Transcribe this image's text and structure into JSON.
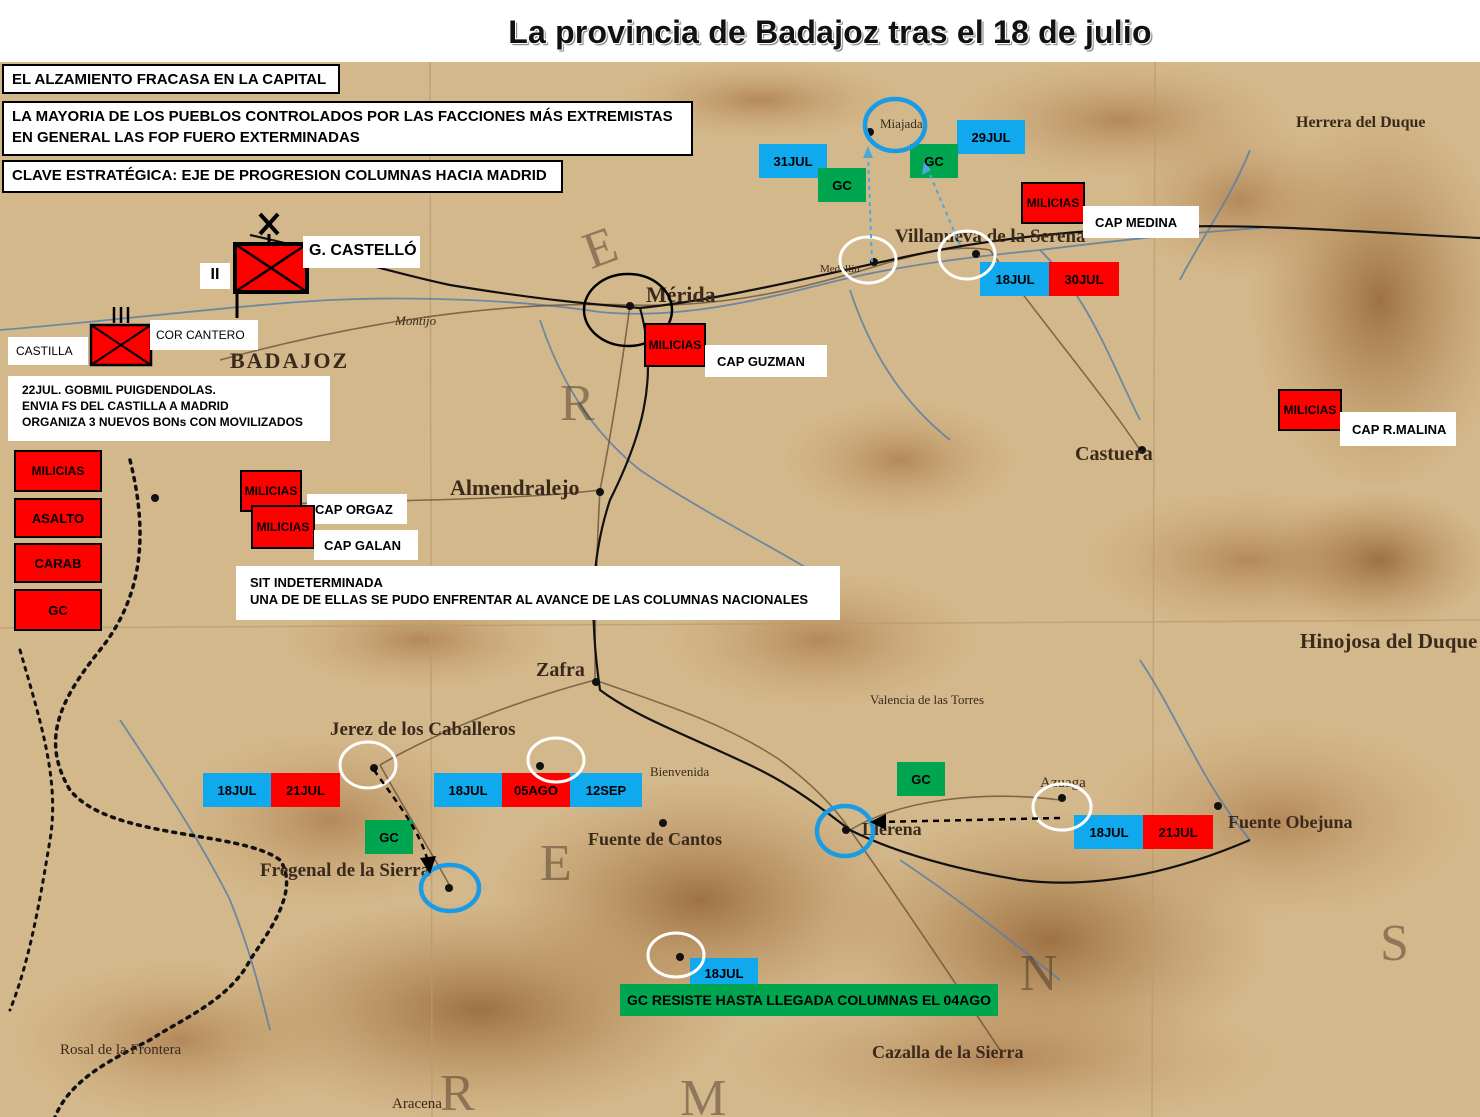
{
  "title": "La provincia de Badajoz tras el 18 de julio",
  "colors": {
    "date_blue": "#11a9ee",
    "date_red": "#ff0000",
    "guardia_civil_green": "#00a550",
    "unit_red": "#ff0000",
    "map_paper": "#d7bf94",
    "map_relief": "#a0703c",
    "circle_blue": "#1a9be6",
    "circle_white": "#ffffff"
  },
  "info_boxes": {
    "alzamiento": "EL ALZAMIENTO FRACASA EN LA CAPITAL",
    "mayoria_line1": "LA MAYORIA DE LOS PUEBLOS CONTROLADOS POR LAS FACCIONES MÁS EXTREMISTAS",
    "mayoria_line2": "EN GENERAL LAS FOP FUERO EXTERMINADAS",
    "clave": "CLAVE ESTRATÉGICA: EJE DE PROGRESION COLUMNAS HACIA MADRID"
  },
  "units": {
    "castello_label": "G. CASTELLÓ",
    "castello_echelon": "II",
    "cantero_label": "COR CANTERO",
    "castilla_label": "CASTILLA",
    "cantero_echelon": "III"
  },
  "note_puigdendolas": {
    "line1": "22JUL. GOBMIL PUIGDENDOLAS.",
    "line2": "ENVIA FS DEL CASTILLA A MADRID",
    "line3": "ORGANIZA 3 NUEVOS BONs CON MOVILIZADOS"
  },
  "legend_stack": [
    "MILICIAS",
    "ASALTO",
    "CARAB",
    "GC"
  ],
  "milicias_label": "MILICIAS",
  "militia_units": {
    "guzman": "CAP GUZMAN",
    "orgaz": "CAP ORGAZ",
    "galan": "CAP GALAN",
    "medina": "CAP MEDINA",
    "malina": "CAP R.MALINA"
  },
  "sit_indeterminada": {
    "line1": "SIT INDETERMINADA",
    "line2": "UNA DE DE ELLAS SE PUDO ENFRENTAR AL AVANCE DE LAS COLUMNAS NACIONALES"
  },
  "badges": {
    "miajadas_date": "29JUL",
    "miajadas_gc": "GC",
    "medellin_date": "31JUL",
    "medellin_gc": "GC",
    "villanueva_start": "18JUL",
    "villanueva_end": "30JUL",
    "jerez_start": "18JUL",
    "jerez_end": "21JUL",
    "jerez_gc": "GC",
    "burguillos_start": "18JUL",
    "burguillos_mid": "05AGO",
    "burguillos_end": "12SEP",
    "llerena_gc": "GC",
    "azuaga_start": "18JUL",
    "azuaga_end": "21JUL",
    "segura_date": "18JUL"
  },
  "banner_gc": "GC RESISTE HASTA LLEGADA COLUMNAS EL 04AGO",
  "places": {
    "badajoz": "BADAJOZ",
    "merida": "Mérida",
    "almendralejo": "Almendralejo",
    "zafra": "Zafra",
    "jerez": "Jerez de los Caballeros",
    "fregenal": "Fregenal de la Sierra",
    "fuente_cantos": "Fuente de Cantos",
    "llerena": "Llerena",
    "azuaga": "Azuaga",
    "villanueva": "Villanueva de la Serena",
    "castuera": "Castuera",
    "hinojosa": "Hinojosa del Duque",
    "cazalla": "Cazalla de la Sierra",
    "medellin": "Medellín",
    "miajadas": "Miajadas",
    "fuente_obejuna": "Fuente Obejuna",
    "aracena": "Aracena",
    "rosal": "Rosal de la Frontera",
    "montijo": "Montijo",
    "valencia_torres": "Valencia de las Torres",
    "bienvenida": "Bienvenida",
    "herrera": "Herrera del Duque"
  }
}
